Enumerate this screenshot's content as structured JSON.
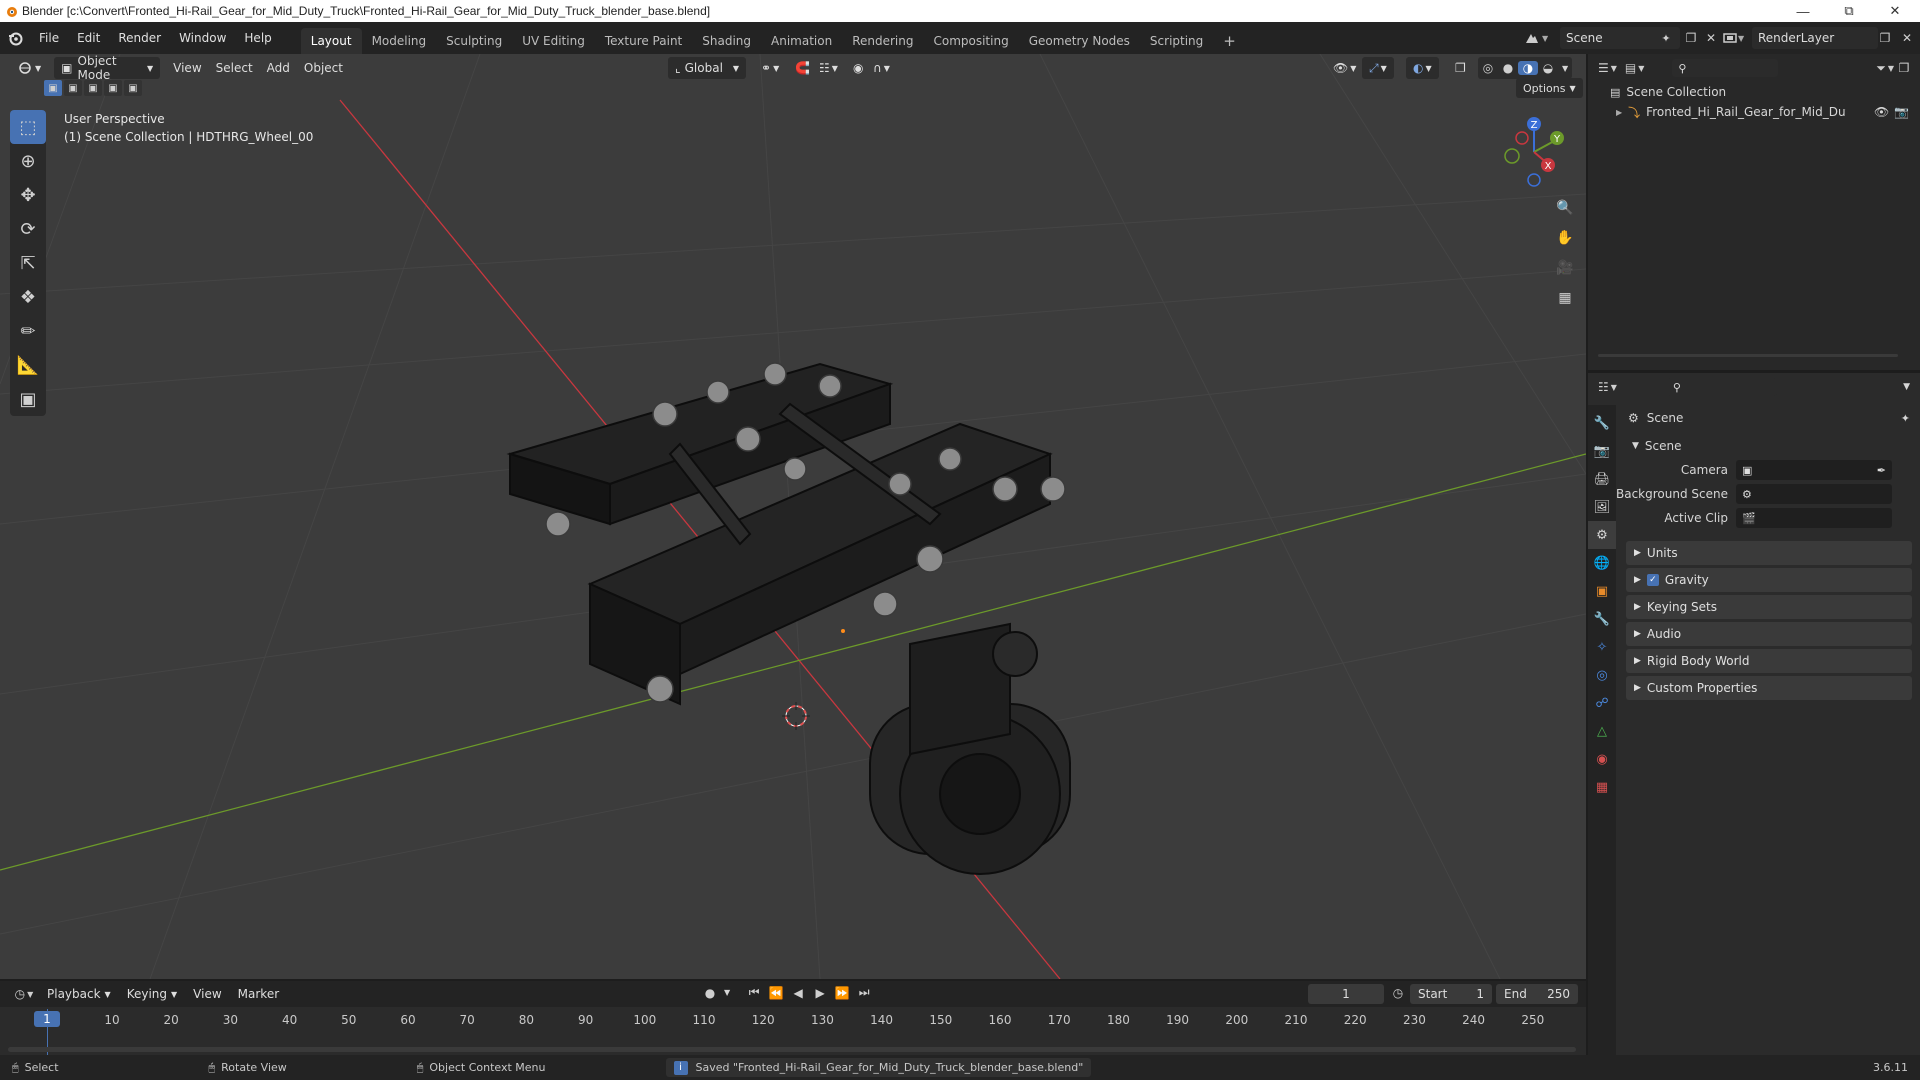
{
  "window": {
    "title": "Blender [c:\\Convert\\Fronted_Hi-Rail_Gear_for_Mid_Duty_Truck\\Fronted_Hi-Rail_Gear_for_Mid_Duty_Truck_blender_base.blend]"
  },
  "menubar": {
    "items": [
      "File",
      "Edit",
      "Render",
      "Window",
      "Help"
    ]
  },
  "workspaces": {
    "tabs": [
      "Layout",
      "Modeling",
      "Sculpting",
      "UV Editing",
      "Texture Paint",
      "Shading",
      "Animation",
      "Rendering",
      "Compositing",
      "Geometry Nodes",
      "Scripting"
    ],
    "active": "Layout",
    "add_label": "+"
  },
  "scene_selector": {
    "value": "Scene"
  },
  "renderlayer_selector": {
    "value": "RenderLayer"
  },
  "viewport": {
    "mode": "Object Mode",
    "menus": [
      "View",
      "Select",
      "Add",
      "Object"
    ],
    "transform_orientation": "Global",
    "options_label": "Options",
    "info_line1": "User Perspective",
    "info_line2": "(1) Scene Collection | HDTHRG_Wheel_00",
    "gizmo": {
      "x": "X",
      "y": "Y",
      "z": "Z"
    }
  },
  "outliner": {
    "root": "Scene Collection",
    "object": "Fronted_Hi_Rail_Gear_for_Mid_Duty_Tru"
  },
  "properties": {
    "header": "Scene",
    "section": "Scene",
    "camera_label": "Camera",
    "background_scene_label": "Background Scene",
    "active_clip_label": "Active Clip",
    "panels": [
      "Units",
      "Gravity",
      "Keying Sets",
      "Audio",
      "Rigid Body World",
      "Custom Properties"
    ],
    "gravity_checked": true
  },
  "timeline": {
    "menus": [
      "Playback",
      "Keying",
      "View",
      "Marker"
    ],
    "current_frame": "1",
    "start_label": "Start",
    "start": "1",
    "end_label": "End",
    "end": "250",
    "ticks": [
      "1",
      "10",
      "20",
      "30",
      "40",
      "50",
      "60",
      "70",
      "80",
      "90",
      "100",
      "110",
      "120",
      "130",
      "140",
      "150",
      "160",
      "170",
      "180",
      "190",
      "200",
      "210",
      "220",
      "230",
      "240",
      "250"
    ]
  },
  "statusbar": {
    "select": "Select",
    "rotate": "Rotate View",
    "context_menu": "Object Context Menu",
    "message": "Saved \"Fronted_Hi-Rail_Gear_for_Mid_Duty_Truck_blender_base.blend\"",
    "version": "3.6.11"
  },
  "colors": {
    "accent": "#4772b3",
    "x_axis": "#c8373f",
    "y_axis": "#6c9a2a",
    "viewport_bg": "#3c3c3c"
  }
}
